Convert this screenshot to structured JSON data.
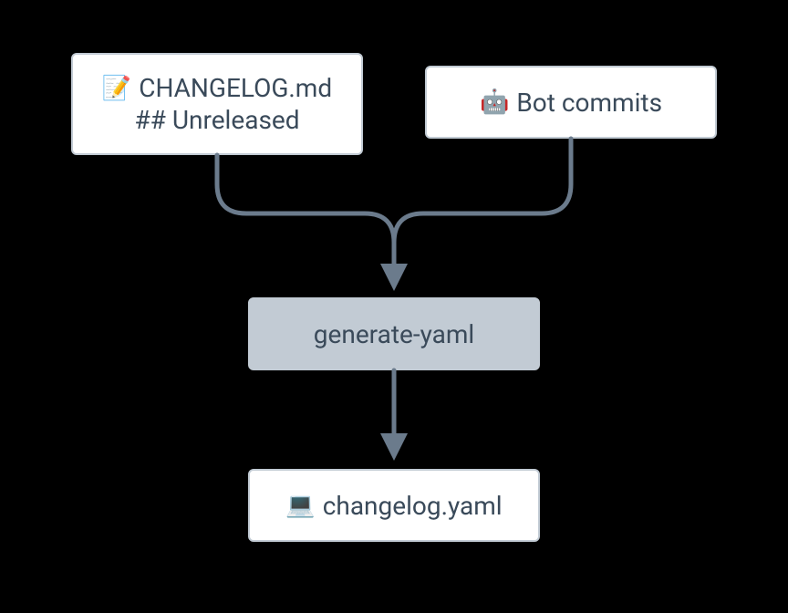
{
  "nodes": {
    "changelog_md": {
      "icon": "📝",
      "title": "CHANGELOG.md",
      "subtitle": "## Unreleased"
    },
    "bot_commits": {
      "icon": "🤖",
      "title": "Bot commits"
    },
    "generate_yaml": {
      "label": "generate-yaml"
    },
    "changelog_yaml": {
      "icon": "💻",
      "title": "changelog.yaml"
    }
  },
  "diagram": {
    "arrow_color": "#6b7b8c",
    "node_border_color": "#c2cbd4",
    "process_fill": "#c2cbd4"
  }
}
